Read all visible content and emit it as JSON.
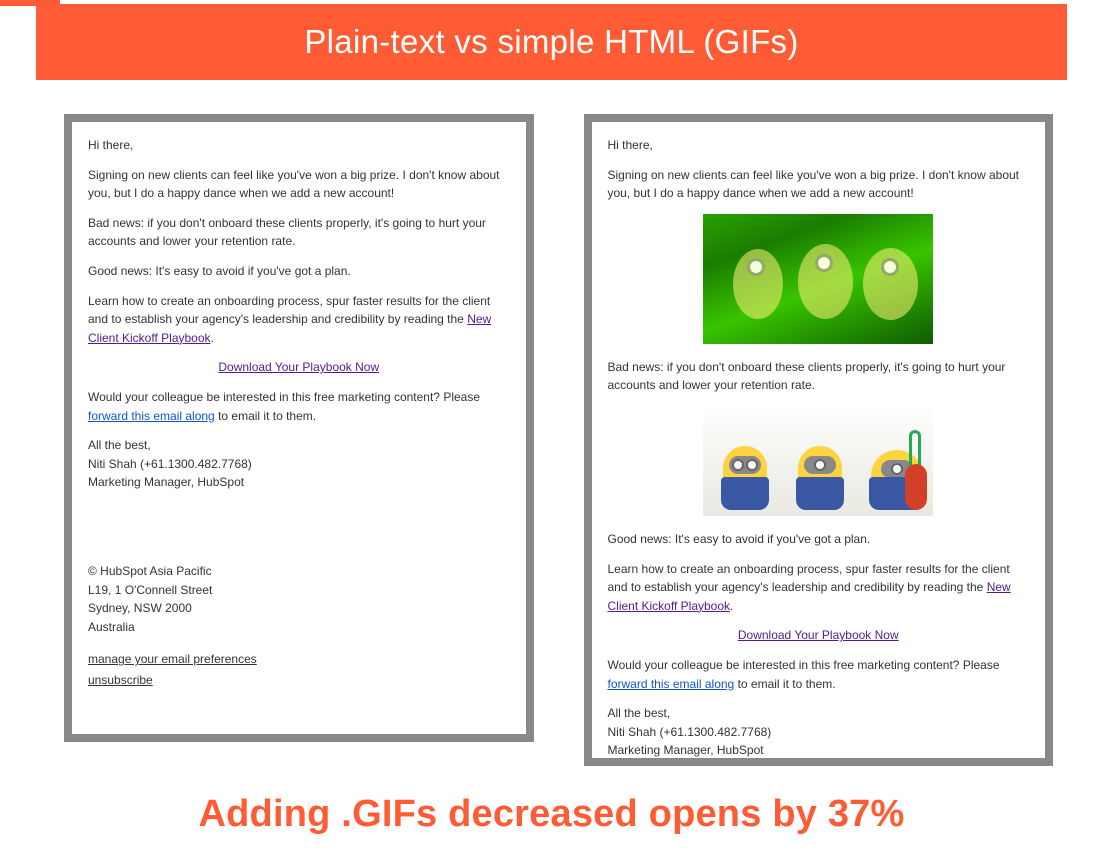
{
  "header": {
    "title": "Plain-text vs simple HTML (GIFs)"
  },
  "footer": {
    "headline": "Adding .GIFs decreased opens by 37%"
  },
  "email_left": {
    "greeting": "Hi there,",
    "p1": "Signing on new clients can feel like you've won a big prize. I don't know about you, but I do a happy dance when we add a new account!",
    "p2": "Bad news: if you don't onboard these clients properly, it's going to hurt your accounts and lower your retention rate.",
    "p3": "Good news: It's easy to avoid if you've got a plan.",
    "p4a": "Learn how to create an onboarding process, spur faster results for the client and to establish your agency's leadership and credibility by reading the ",
    "link1": "New Client Kickoff Playbook",
    "p4b": ".",
    "cta": "Download Your Playbook Now",
    "p5a": "Would your colleague be interested in this free marketing content? Please ",
    "link2": "forward this email along",
    "p5b": " to email it to them.",
    "sig1": "All the best,",
    "sig2": "Niti Shah (+61.1300.482.7768)",
    "sig3": "Marketing Manager, HubSpot",
    "addr1": "© HubSpot Asia Pacific",
    "addr2": "L19, 1 O'Connell Street",
    "addr3": "Sydney, NSW 2000",
    "addr4": "Australia",
    "pref": "manage your email preferences",
    "unsub": "unsubscribe"
  },
  "email_right": {
    "greeting": "Hi there,",
    "p1": "Signing on new clients can feel like you've won a big prize. I don't know about you, but I do a happy dance when we add a new account!",
    "p2": "Bad news: if you don't onboard these clients properly, it's going to hurt your accounts and lower your retention rate.",
    "p3": "Good news: It's easy to avoid if you've got a plan.",
    "p4a": "Learn how to create an onboarding process, spur faster results for the client and to establish your agency's leadership and credibility by reading the ",
    "link1": "New Client Kickoff Playbook",
    "p4b": ".",
    "cta": "Download Your Playbook Now",
    "p5a": "Would your colleague be interested in this free marketing content? Please ",
    "link2": "forward this email along",
    "p5b": " to email it to them.",
    "sig1": "All the best,",
    "sig2": "Niti Shah (+61.1300.482.7768)",
    "sig3": "Marketing Manager, HubSpot"
  }
}
